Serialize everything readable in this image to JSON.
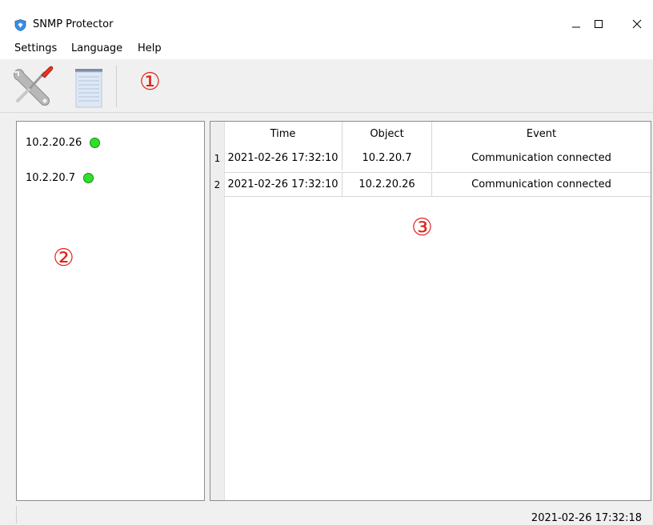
{
  "window": {
    "title": "SNMP Protector",
    "controls": [
      "minimize",
      "maximize",
      "close"
    ]
  },
  "menu": {
    "items": [
      {
        "label": "Settings"
      },
      {
        "label": "Language"
      },
      {
        "label": "Help"
      }
    ]
  },
  "toolbar": {
    "buttons": [
      {
        "icon": "tools-icon"
      },
      {
        "icon": "notepad-icon"
      }
    ]
  },
  "markers": {
    "toolbar": "①",
    "devices": "②",
    "events": "③"
  },
  "devices": [
    {
      "ip": "10.2.20.26",
      "status": "online"
    },
    {
      "ip": "10.2.20.7",
      "status": "online"
    }
  ],
  "events": {
    "columns": [
      "Time",
      "Object",
      "Event"
    ],
    "rows": [
      {
        "num": "1",
        "time": "2021-02-26 17:32:10",
        "object": "10.2.20.7",
        "event": "Communication connected"
      },
      {
        "num": "2",
        "time": "2021-02-26 17:32:10",
        "object": "10.2.20.26",
        "event": "Communication connected"
      }
    ]
  },
  "status": {
    "datetime": "2021-02-26 17:32:18"
  },
  "colors": {
    "marker": "#e0231b",
    "online": "#2ee02a",
    "accent": "#1e6fd9"
  }
}
